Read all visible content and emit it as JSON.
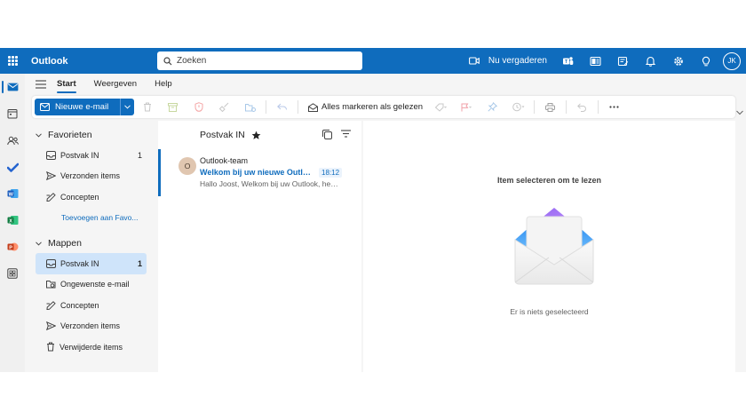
{
  "app": {
    "name": "Outlook",
    "accent": "#0f6cbd"
  },
  "search": {
    "placeholder": "Zoeken"
  },
  "topbar": {
    "meet_now": "Nu vergaderen",
    "user_initials": "JK"
  },
  "tabs": [
    "Start",
    "Weergeven",
    "Help"
  ],
  "ribbon": {
    "new_mail": "Nieuwe e-mail",
    "mark_all_read": "Alles markeren als gelezen"
  },
  "folders": {
    "favorites_title": "Favorieten",
    "favorites": [
      {
        "label": "Postvak IN",
        "count": "1",
        "icon": "inbox-icon"
      },
      {
        "label": "Verzonden items",
        "count": "",
        "icon": "send-icon"
      },
      {
        "label": "Concepten",
        "count": "",
        "icon": "draft-icon"
      }
    ],
    "add_favorite": "Toevoegen aan Favo...",
    "folders_title": "Mappen",
    "items": [
      {
        "label": "Postvak IN",
        "count": "1",
        "icon": "inbox-icon"
      },
      {
        "label": "Ongewenste e-mail",
        "count": "",
        "icon": "junk-icon"
      },
      {
        "label": "Concepten",
        "count": "",
        "icon": "draft-icon"
      },
      {
        "label": "Verzonden items",
        "count": "",
        "icon": "send-icon"
      },
      {
        "label": "Verwijderde items",
        "count": "",
        "icon": "trash-icon"
      }
    ]
  },
  "message_list": {
    "title": "Postvak IN",
    "messages": [
      {
        "avatar": "O",
        "from": "Outlook-team",
        "subject": "Welkom bij uw nieuwe Outlook.com-account",
        "time": "18:12",
        "preview": "Hallo Joost, Welkom bij uw Outlook, het nieuwe account"
      }
    ]
  },
  "reading_pane": {
    "title": "Item selecteren om te lezen",
    "empty": "Er is niets geselecteerd"
  }
}
